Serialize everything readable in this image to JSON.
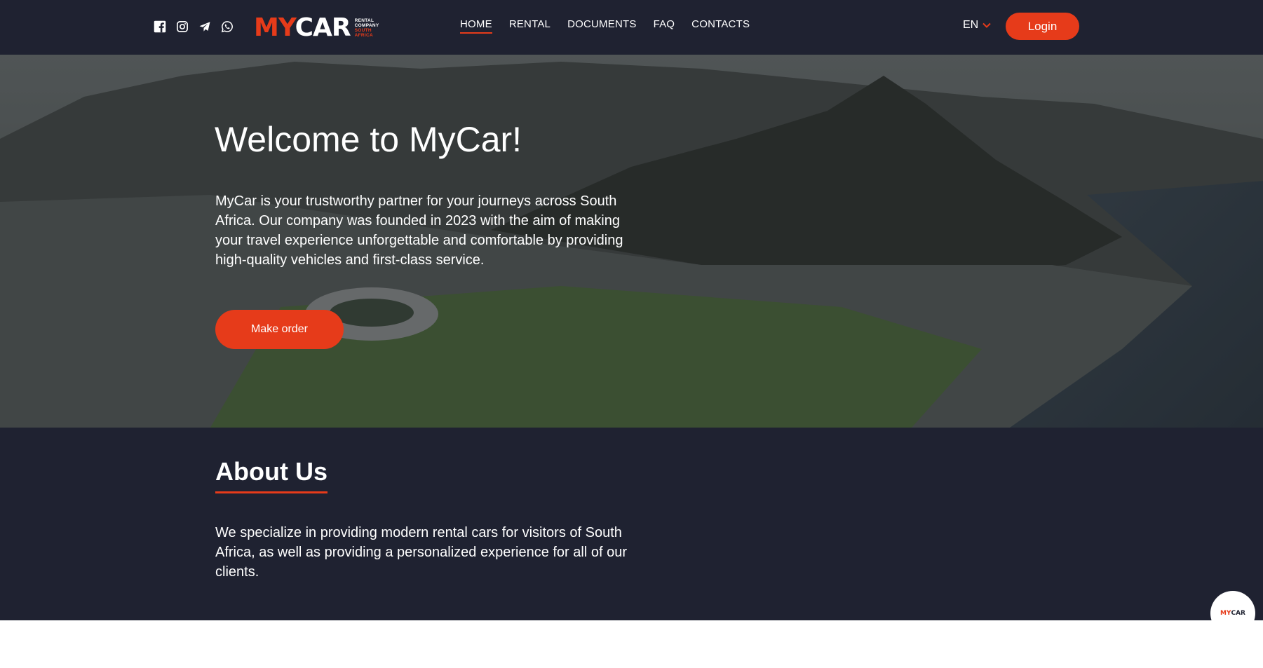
{
  "header": {
    "socials": [
      {
        "icon": "facebook-icon"
      },
      {
        "icon": "instagram-icon"
      },
      {
        "icon": "telegram-icon"
      },
      {
        "icon": "whatsapp-icon"
      }
    ],
    "logo": {
      "part1": "MY",
      "part2": "CAR",
      "sub1": "RENTAL",
      "sub2": "COMPANY",
      "sub3": "SOUTH",
      "sub4": "AFRICA"
    },
    "nav": [
      {
        "label": "HOME",
        "active": true
      },
      {
        "label": "RENTAL",
        "active": false
      },
      {
        "label": "DOCUMENTS",
        "active": false
      },
      {
        "label": "FAQ",
        "active": false
      },
      {
        "label": "CONTACTS",
        "active": false
      }
    ],
    "language": "EN",
    "login_label": "Login"
  },
  "hero": {
    "title": "Welcome to MyCar!",
    "text": "MyCar is your trustworthy partner for your journeys across South Africa. Our company was founded in 2023 with the aim of making your travel experience unforgettable and comfortable by providing high-quality vehicles and first-class service.",
    "button_label": "Make order"
  },
  "about": {
    "title": "About Us",
    "text": "We specialize in providing modern rental cars for visitors of South Africa, as well as providing a personalized experience for all of our clients."
  },
  "float_logo": {
    "part1": "MY",
    "part2": "CAR"
  },
  "colors": {
    "accent": "#e63b1a",
    "dark": "#1f2231",
    "white": "#ffffff"
  }
}
